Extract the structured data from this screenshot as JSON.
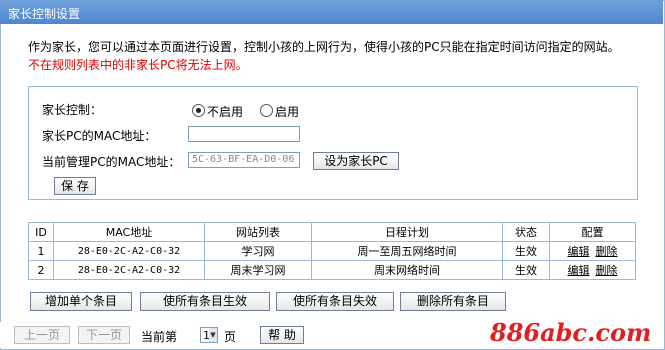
{
  "title": "家长控制设置",
  "description": "作为家长，您可以通过本页面进行设置，控制小孩的上网行为，使得小孩的PC只能在指定时间访问指定的网站。",
  "warning": "不在规则列表中的非家长PC将无法上网。",
  "form": {
    "control_label": "家长控制：",
    "disable_label": "不启用",
    "enable_label": "启用",
    "selected": "不启用",
    "parent_mac_label": "家长PC的MAC地址：",
    "parent_mac_value": "",
    "current_mac_label": "当前管理PC的MAC地址：",
    "current_mac_value": "5C-63-BF-EA-D0-06",
    "set_parent_button": "设为家长PC",
    "save_button": "保 存"
  },
  "table": {
    "headers": [
      "ID",
      "MAC地址",
      "网站列表",
      "日程计划",
      "状态",
      "配置"
    ],
    "rows": [
      {
        "id": "1",
        "mac": "28-E0-2C-A2-C0-32",
        "sites": "学习网",
        "schedule": "周一至周五网络时间",
        "status": "生效",
        "edit": "编辑",
        "delete": "删除"
      },
      {
        "id": "2",
        "mac": "28-E0-2C-A2-C0-32",
        "sites": "周末学习网",
        "schedule": "周末网络时间",
        "status": "生效",
        "edit": "编辑",
        "delete": "删除"
      }
    ]
  },
  "actions": {
    "add": "增加单个条目",
    "enable_all": "使所有条目生效",
    "disable_all": "使所有条目失效",
    "delete_all": "删除所有条目"
  },
  "pager": {
    "prev": "上一页",
    "next": "下一页",
    "current_label": "当前第",
    "page": "1",
    "page_unit": "页",
    "help": "帮 助"
  },
  "watermark": "886abc.com"
}
